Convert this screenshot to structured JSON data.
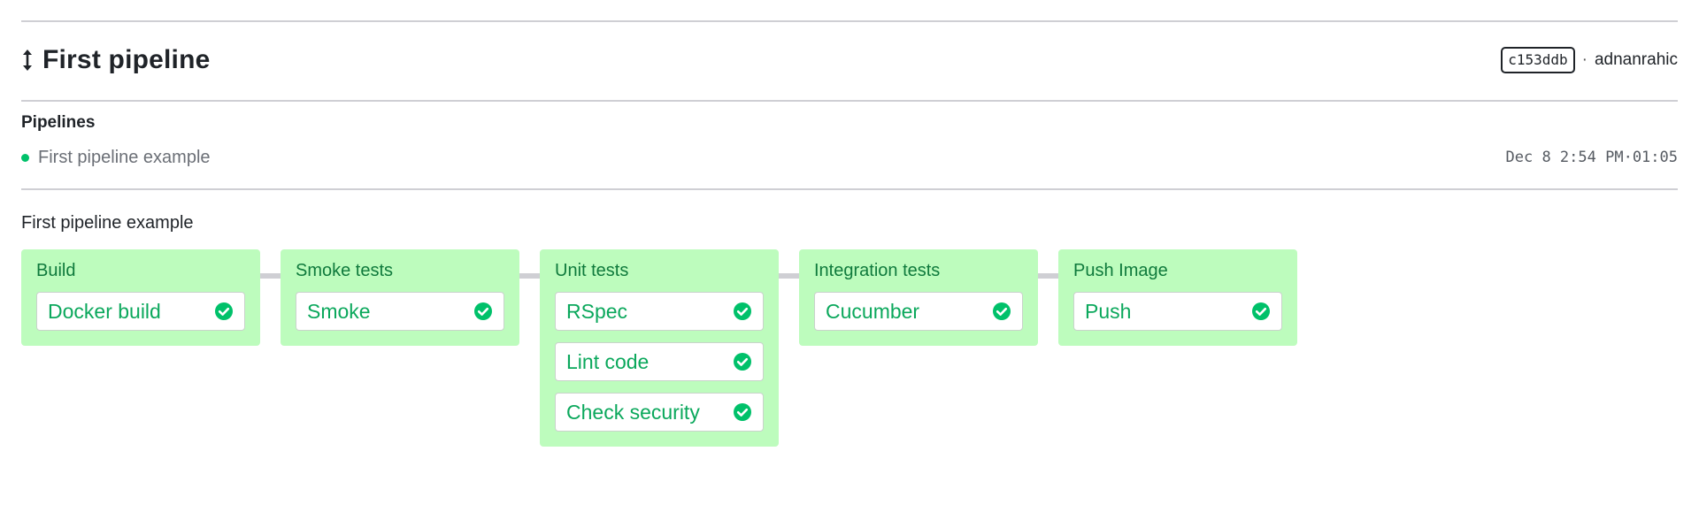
{
  "header": {
    "title": "First pipeline",
    "title_icon": "updown-arrow-icon",
    "commit": "c153ddb",
    "separator": "·",
    "author": "adnanrahic"
  },
  "pipelines": {
    "heading": "Pipelines",
    "items": [
      {
        "name": "First pipeline example",
        "status": "passed",
        "status_color": "#00c16a",
        "timestamp": "Dec 8 2:54 PM",
        "separator": "·",
        "duration": "01:05"
      }
    ]
  },
  "pipeline": {
    "title": "First pipeline example",
    "stage_color": "#bdfcbd",
    "job_text_color": "#0ba85c",
    "stages": [
      {
        "name": "Build",
        "jobs": [
          {
            "name": "Docker build",
            "status": "passed"
          }
        ]
      },
      {
        "name": "Smoke tests",
        "jobs": [
          {
            "name": "Smoke",
            "status": "passed"
          }
        ]
      },
      {
        "name": "Unit tests",
        "jobs": [
          {
            "name": "RSpec",
            "status": "passed"
          },
          {
            "name": "Lint code",
            "status": "passed"
          },
          {
            "name": "Check security",
            "status": "passed"
          }
        ]
      },
      {
        "name": "Integration tests",
        "jobs": [
          {
            "name": "Cucumber",
            "status": "passed"
          }
        ]
      },
      {
        "name": "Push Image",
        "jobs": [
          {
            "name": "Push",
            "status": "passed"
          }
        ]
      }
    ]
  },
  "colors": {
    "success": "#00c16a",
    "stage_bg": "#bdfcbd",
    "stage_title": "#0f7a3c",
    "divider": "#cfcfd4"
  }
}
